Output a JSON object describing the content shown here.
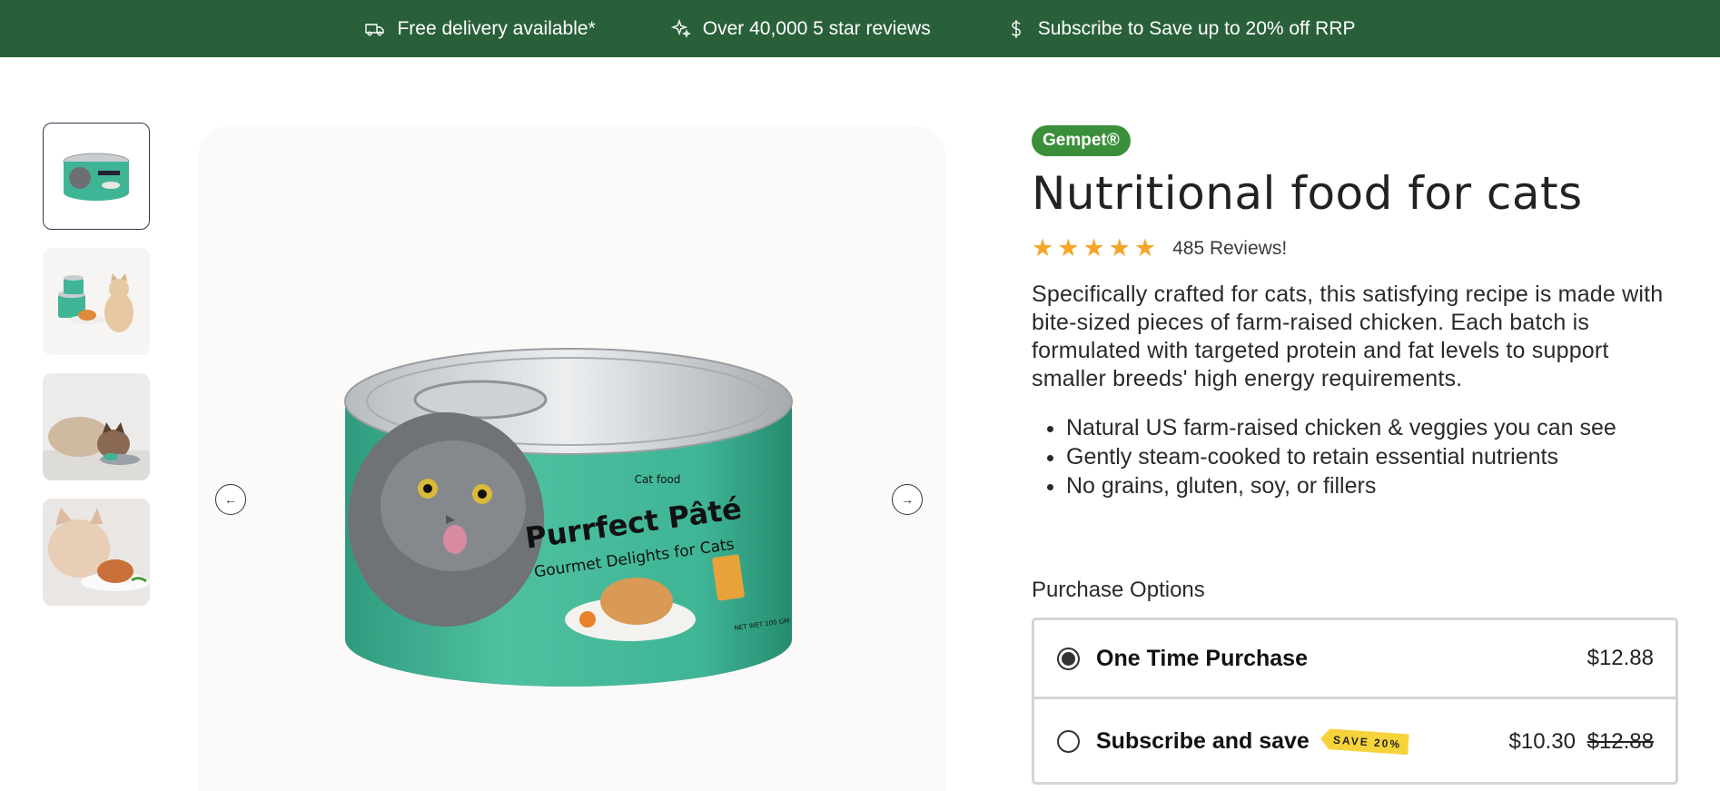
{
  "banner": {
    "items": [
      {
        "icon": "truck-icon",
        "text": "Free delivery available*"
      },
      {
        "icon": "sparkle-icon",
        "text": "Over 40,000 5 star reviews"
      },
      {
        "icon": "dollar-icon",
        "text": "Subscribe to Save up to 20% off RRP"
      }
    ]
  },
  "gallery": {
    "thumbnails": [
      "can-thumbnail",
      "cat-with-cans-thumbnail",
      "cat-eating-thumbnail",
      "kitten-eating-thumbnail"
    ],
    "active_index": 0,
    "main_image": {
      "brand_line": "Cat food",
      "product_name": "Purrfect Pâté",
      "tagline": "Gourmet Delights for Cats",
      "net_weight": "NET WET 100 GM"
    },
    "nav": {
      "prev_icon": "arrow-left-icon",
      "next_icon": "arrow-right-icon"
    }
  },
  "product": {
    "brand": "Gempet®",
    "title": "Nutritional food for cats",
    "rating": 5,
    "reviews_label": "485 Reviews!",
    "description": "Specifically crafted for cats, this satisfying recipe is made with bite-sized pieces of farm-raised chicken. Each batch is formulated with targeted protein and fat levels to support smaller breeds' high energy requirements.",
    "bullets": [
      "Natural US farm-raised chicken & veggies you can see",
      "Gently steam-cooked to retain essential nutrients",
      "No grains, gluten, soy, or fillers"
    ]
  },
  "purchase": {
    "label": "Purchase Options",
    "options": [
      {
        "label": "One Time Purchase",
        "price": "$12.88",
        "selected": true
      },
      {
        "label": "Subscribe and save",
        "badge": "SAVE 20%",
        "price": "$10.30",
        "old_price": "$12.88",
        "selected": false
      }
    ]
  },
  "colors": {
    "banner_bg": "#29603a",
    "brand_badge": "#3b8f3b",
    "star": "#f4a62a",
    "save_badge": "#f6d33a"
  }
}
